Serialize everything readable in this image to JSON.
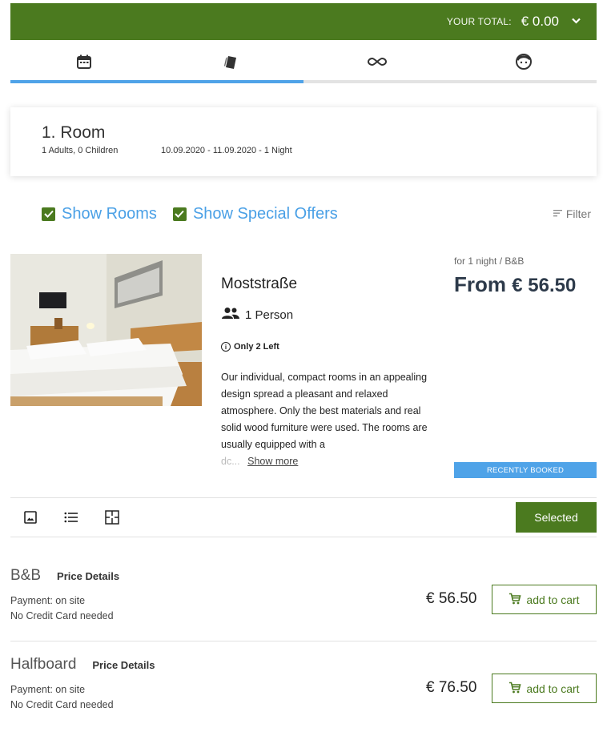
{
  "header": {
    "total_label": "YOUR TOTAL:",
    "total_value": "€ 0.00"
  },
  "steps": {
    "icons": [
      "calendar-icon",
      "room-cards-icon",
      "infinity-icon",
      "guest-face-icon"
    ],
    "progress_fraction": 0.5
  },
  "room_summary": {
    "title": "1. Room",
    "guests": "1 Adults, 0 Children",
    "dates": "10.09.2020 - 11.09.2020 - 1 Night"
  },
  "filters": {
    "show_rooms": "Show Rooms",
    "show_offers": "Show Special Offers",
    "filter": "Filter"
  },
  "room": {
    "name": "Moststraße",
    "persons": "1 Person",
    "availability": "Only 2 Left",
    "description": "Our individual, compact rooms in an appealing design spread a pleasant and relaxed atmosphere. Only the best materials and real solid wood furniture were used. The rooms are usually equipped with a",
    "description_fade": "dc...",
    "show_more": "Show more",
    "per_label": "for 1 night / B&B",
    "from_label": "From",
    "from_price": "€ 56.50",
    "badge": "RECENTLY BOOKED",
    "selected_label": "Selected"
  },
  "rates": [
    {
      "title": "B&B",
      "details": "Price Details",
      "payment": "Payment: on site",
      "card": "No Credit Card needed",
      "price": "€ 56.50",
      "cart": "add to cart"
    },
    {
      "title": "Halfboard",
      "details": "Price Details",
      "payment": "Payment: on site",
      "card": "No Credit Card needed",
      "price": "€ 76.50",
      "cart": "add to cart"
    }
  ],
  "colors": {
    "brand_green": "#4b7a1f",
    "accent_blue": "#4fa3e8"
  }
}
